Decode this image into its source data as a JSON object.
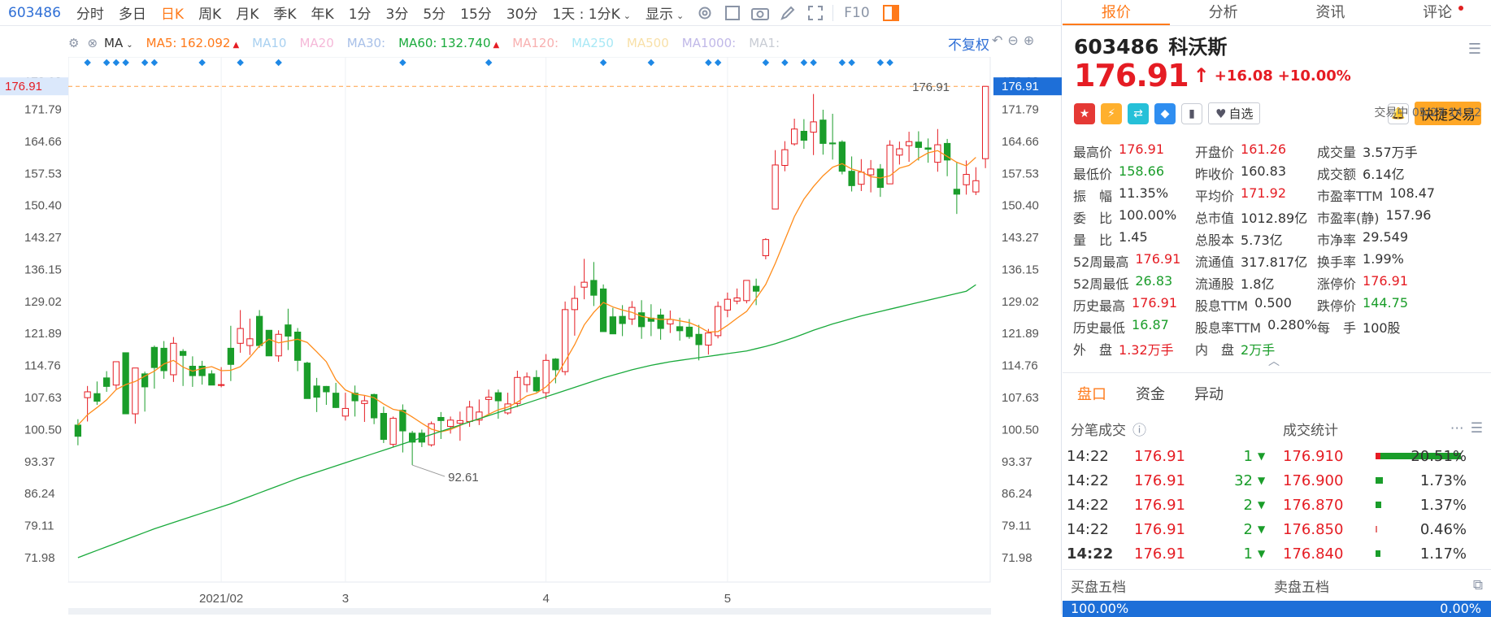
{
  "toolbar": {
    "symbol": "603486",
    "periods": [
      "分时",
      "多日",
      "日K",
      "周K",
      "月K",
      "季K",
      "年K",
      "1分",
      "3分",
      "5分",
      "15分",
      "30分"
    ],
    "active_period": "日K",
    "combo_label": "1天 : 1分K",
    "display_label": "显示",
    "f10_label": "F10"
  },
  "ma_bar": {
    "indicator": "MA",
    "items": [
      {
        "label": "MA5:",
        "value": "162.092",
        "color": "#ff7a1a",
        "arrow": "▲"
      },
      {
        "label": "MA10",
        "value": "",
        "color": "#a8d0f0",
        "arrow": ""
      },
      {
        "label": "MA20",
        "value": "",
        "color": "#f5b8d8",
        "arrow": ""
      },
      {
        "label": "MA30:",
        "value": "",
        "color": "#a8c0e8",
        "arrow": ""
      },
      {
        "label": "MA60:",
        "value": "132.740",
        "color": "#1aaa3c",
        "arrow": "▲"
      },
      {
        "label": "MA120:",
        "value": "",
        "color": "#f8b0b0",
        "arrow": ""
      },
      {
        "label": "MA250",
        "value": "",
        "color": "#a8e8f5",
        "arrow": ""
      },
      {
        "label": "MA500",
        "value": "",
        "color": "#f8e0a8",
        "arrow": ""
      },
      {
        "label": "MA1000:",
        "value": "",
        "color": "#c0b8e8",
        "arrow": ""
      },
      {
        "label": "MA1:",
        "value": "",
        "color": "#c8ccd4",
        "arrow": ""
      }
    ],
    "adjust_label": "不复权"
  },
  "chart_data": {
    "type": "candlestick",
    "y_ticks": [
      "178.03",
      "171.79",
      "164.66",
      "157.53",
      "150.40",
      "143.27",
      "136.15",
      "129.02",
      "121.89",
      "114.76",
      "107.63",
      "100.50",
      "93.37",
      "86.24",
      "79.11",
      "71.98"
    ],
    "ylim": [
      71.98,
      178.03
    ],
    "x_labels": [
      {
        "label": "2021/02",
        "index": 15
      },
      {
        "label": "3",
        "index": 28
      },
      {
        "label": "4",
        "index": 49
      },
      {
        "label": "5",
        "index": 68
      }
    ],
    "current_price_label": "176.91",
    "high_annotation": "176.91",
    "low_annotation": "92.61",
    "candles": [
      [
        101.5,
        102.8,
        99.0,
        97.0
      ],
      [
        107.6,
        110.2,
        108.9,
        102.3
      ],
      [
        108.5,
        111.2,
        106.8,
        106.0
      ],
      [
        112.0,
        113.5,
        110.1,
        108.9
      ],
      [
        110.4,
        113.0,
        115.6,
        109.5
      ],
      [
        117.6,
        117.6,
        104.0,
        104.0
      ],
      [
        104.0,
        113.4,
        114.2,
        101.8
      ],
      [
        112.9,
        113.4,
        110.0,
        104.5
      ],
      [
        118.8,
        119.2,
        114.3,
        109.6
      ],
      [
        118.6,
        120.2,
        113.6,
        111.8
      ],
      [
        112.7,
        121.1,
        119.7,
        111.1
      ],
      [
        117.9,
        118.4,
        117.0,
        110.2
      ],
      [
        114.6,
        116.8,
        112.5,
        110.0
      ],
      [
        114.6,
        115.8,
        112.5,
        110.5
      ],
      [
        112.9,
        113.7,
        110.4,
        110.4
      ],
      [
        110.4,
        114.4,
        110.5,
        109.9
      ],
      [
        118.6,
        123.6,
        115.0,
        111.3
      ],
      [
        119.7,
        127.1,
        123.0,
        117.6
      ],
      [
        119.2,
        125.2,
        120.7,
        117.1
      ],
      [
        125.7,
        127.1,
        119.2,
        118.7
      ],
      [
        122.6,
        122.6,
        116.9,
        116.9
      ],
      [
        116.9,
        122.6,
        121.7,
        115.6
      ],
      [
        123.8,
        127.4,
        121.3,
        118.2
      ],
      [
        122.2,
        123.1,
        115.9,
        113.5
      ],
      [
        115.3,
        115.6,
        107.4,
        107.4
      ],
      [
        110.2,
        112.0,
        107.7,
        104.4
      ],
      [
        110.1,
        110.2,
        108.9,
        106.0
      ],
      [
        108.6,
        110.9,
        105.4,
        105.3
      ],
      [
        103.5,
        108.7,
        105.2,
        102.5
      ],
      [
        108.6,
        110.3,
        106.9,
        103.4
      ],
      [
        106.3,
        108.1,
        106.9,
        102.2
      ],
      [
        108.3,
        108.5,
        103.1,
        101.7
      ],
      [
        104.1,
        105.6,
        98.3,
        97.5
      ],
      [
        97.2,
        103.4,
        103.0,
        96.6
      ],
      [
        104.8,
        106.1,
        100.2,
        95.4
      ],
      [
        99.7,
        100.2,
        97.7,
        92.6
      ],
      [
        99.7,
        100.5,
        97.7,
        96.6
      ],
      [
        97.1,
        102.3,
        101.8,
        96.7
      ],
      [
        103.2,
        104.4,
        102.5,
        98.4
      ],
      [
        101.2,
        103.4,
        102.6,
        99.6
      ],
      [
        101.9,
        104.5,
        102.5,
        98.0
      ],
      [
        102.3,
        106.9,
        105.5,
        101.1
      ],
      [
        102.6,
        107.2,
        104.4,
        101.5
      ],
      [
        107.2,
        109.4,
        107.7,
        104.0
      ],
      [
        108.7,
        109.4,
        106.9,
        102.9
      ],
      [
        104.2,
        108.7,
        106.2,
        103.8
      ],
      [
        106.3,
        113.6,
        112.1,
        105.5
      ],
      [
        110.5,
        113.2,
        112.2,
        108.8
      ],
      [
        112.1,
        113.7,
        109.1,
        108.8
      ],
      [
        108.7,
        117.3,
        115.9,
        107.3
      ],
      [
        116.2,
        116.4,
        113.8,
        110.8
      ],
      [
        113.4,
        129.0,
        127.2,
        112.6
      ],
      [
        127.2,
        132.5,
        129.7,
        121.4
      ],
      [
        132.2,
        138.5,
        133.3,
        129.5
      ],
      [
        133.7,
        137.8,
        130.4,
        128.0
      ],
      [
        131.8,
        132.8,
        122.3,
        122.3
      ],
      [
        125.6,
        127.6,
        121.8,
        121.8
      ],
      [
        125.7,
        128.2,
        124.1,
        121.3
      ],
      [
        125.1,
        129.1,
        127.7,
        123.8
      ],
      [
        126.5,
        129.3,
        123.4,
        120.7
      ],
      [
        125.3,
        128.4,
        124.6,
        121.3
      ],
      [
        126.0,
        127.4,
        123.0,
        120.5
      ],
      [
        124.0,
        127.0,
        125.0,
        122.0
      ],
      [
        123.4,
        125.4,
        122.5,
        120.3
      ],
      [
        123.3,
        125.1,
        121.2,
        120.7
      ],
      [
        121.7,
        123.8,
        119.4,
        115.9
      ],
      [
        119.3,
        122.9,
        122.0,
        117.2
      ],
      [
        121.4,
        129.0,
        127.9,
        120.8
      ],
      [
        127.1,
        131.0,
        129.5,
        125.5
      ],
      [
        129.1,
        131.9,
        129.8,
        128.4
      ],
      [
        129.2,
        132.2,
        133.7,
        128.6
      ],
      [
        132.4,
        134.1,
        131.3,
        128.2
      ],
      [
        139.2,
        143.1,
        142.8,
        138.4
      ],
      [
        149.6,
        162.7,
        159.4,
        149.6
      ],
      [
        159.3,
        164.7,
        162.8,
        158.0
      ],
      [
        164.1,
        169.7,
        167.4,
        163.7
      ],
      [
        166.9,
        169.6,
        164.9,
        163.0
      ],
      [
        166.7,
        175.2,
        169.0,
        161.6
      ],
      [
        169.4,
        171.7,
        164.2,
        161.7
      ],
      [
        164.3,
        170.8,
        164.1,
        160.6
      ],
      [
        164.5,
        164.9,
        158.0,
        157.3
      ],
      [
        158.0,
        161.3,
        154.8,
        153.5
      ],
      [
        155.1,
        160.7,
        157.8,
        153.6
      ],
      [
        157.2,
        160.5,
        158.5,
        153.3
      ],
      [
        158.5,
        159.6,
        154.4,
        152.3
      ],
      [
        155.2,
        164.9,
        163.8,
        155.2
      ],
      [
        161.6,
        164.6,
        163.0,
        159.5
      ],
      [
        163.7,
        166.8,
        164.6,
        160.1
      ],
      [
        164.5,
        166.9,
        163.3,
        160.4
      ],
      [
        163.2,
        165.3,
        162.9,
        159.9
      ],
      [
        160.0,
        167.4,
        163.9,
        157.9
      ],
      [
        164.2,
        165.2,
        160.5,
        156.9
      ],
      [
        154.0,
        159.9,
        152.9,
        148.5
      ],
      [
        155.0,
        160.4,
        157.3,
        152.8
      ],
      [
        153.4,
        158.9,
        155.9,
        152.7
      ],
      [
        160.8,
        176.9,
        176.9,
        158.7
      ]
    ],
    "ma5": [
      101.5,
      103.8,
      105.4,
      107.1,
      109.4,
      110.5,
      111.2,
      112.4,
      113.5,
      115.1,
      115.9,
      114.4,
      113.5,
      114.1,
      114.5,
      113.6,
      113.7,
      114.5,
      116.6,
      119.1,
      120.6,
      119.8,
      120.2,
      120.6,
      119.9,
      117.8,
      115.6,
      111.6,
      109.3,
      108.4,
      108.1,
      107.6,
      106.2,
      105.0,
      104.6,
      103.3,
      101.9,
      100.6,
      100.0,
      100.5,
      101.4,
      102.3,
      102.8,
      103.9,
      104.9,
      105.5,
      106.6,
      108.0,
      108.6,
      110.0,
      112.1,
      115.7,
      119.4,
      123.8,
      126.6,
      128.8,
      127.8,
      127.1,
      126.6,
      125.7,
      125.3,
      125.0,
      125.1,
      124.7,
      124.3,
      123.4,
      122.2,
      122.3,
      123.7,
      125.3,
      126.8,
      129.7,
      132.8,
      137.5,
      142.7,
      147.9,
      151.8,
      154.6,
      157.0,
      158.9,
      159.7,
      158.5,
      157.9,
      156.8,
      156.5,
      157.0,
      158.7,
      159.3,
      160.9,
      162.1,
      162.6,
      161.3,
      160.0,
      159.2,
      161.1
    ],
    "ma60": [
      71.98,
      72.8,
      73.6,
      74.4,
      75.2,
      76.0,
      76.8,
      77.6,
      78.4,
      79.1,
      79.8,
      80.5,
      81.2,
      81.9,
      82.6,
      83.3,
      84.0,
      84.8,
      85.6,
      86.4,
      87.2,
      88.0,
      88.8,
      89.6,
      90.3,
      91.0,
      91.7,
      92.4,
      93.1,
      93.8,
      94.5,
      95.2,
      95.9,
      96.6,
      97.3,
      98.0,
      98.7,
      99.4,
      100.1,
      100.8,
      101.5,
      102.2,
      102.9,
      103.6,
      104.3,
      105.0,
      105.7,
      106.4,
      107.1,
      107.8,
      108.5,
      109.2,
      109.9,
      110.6,
      111.3,
      112.0,
      112.6,
      113.2,
      113.8,
      114.3,
      114.8,
      115.2,
      115.6,
      115.9,
      116.2,
      116.5,
      116.8,
      117.1,
      117.4,
      117.7,
      118.0,
      118.5,
      119.0,
      119.6,
      120.3,
      121.0,
      121.8,
      122.6,
      123.3,
      124.0,
      124.6,
      125.2,
      125.8,
      126.3,
      126.8,
      127.3,
      127.8,
      128.3,
      128.8,
      129.3,
      129.8,
      130.3,
      130.8,
      131.3,
      132.74
    ]
  },
  "stock": {
    "code": "603486",
    "name": "科沃斯",
    "price": "176.91",
    "arrow": "↑",
    "change": "+16.08",
    "change_pct": "+10.00%",
    "status": "交易中 05/27 14:22",
    "watch_label": "自选",
    "trade_button": "快捷交易"
  },
  "panel_tabs": [
    "报价",
    "分析",
    "资讯",
    "评论"
  ],
  "quote_grid": [
    [
      {
        "l": "最高价",
        "v": "176.91",
        "c": "red"
      },
      {
        "l": "开盘价",
        "v": "161.26",
        "c": "red"
      },
      {
        "l": "成交量",
        "v": "3.57万手",
        "c": "dark"
      }
    ],
    [
      {
        "l": "最低价",
        "v": "158.66",
        "c": "green"
      },
      {
        "l": "昨收价",
        "v": "160.83",
        "c": "dark"
      },
      {
        "l": "成交额",
        "v": "6.14亿",
        "c": "dark"
      }
    ],
    [
      {
        "l": "振　幅",
        "v": "11.35%",
        "c": "dark"
      },
      {
        "l": "平均价",
        "v": "171.92",
        "c": "red"
      },
      {
        "l": "市盈率TTM",
        "v": "108.47",
        "c": "dark"
      }
    ],
    [
      {
        "l": "委　比",
        "v": "100.00%",
        "c": "dark"
      },
      {
        "l": "总市值",
        "v": "1012.89亿",
        "c": "dark"
      },
      {
        "l": "市盈率(静)",
        "v": "157.96",
        "c": "dark"
      }
    ],
    [
      {
        "l": "量　比",
        "v": "1.45",
        "c": "dark"
      },
      {
        "l": "总股本",
        "v": "5.73亿",
        "c": "dark"
      },
      {
        "l": "市净率",
        "v": "29.549",
        "c": "dark"
      }
    ],
    [
      {
        "l": "52周最高",
        "v": "176.91",
        "c": "red"
      },
      {
        "l": "流通值",
        "v": "317.817亿",
        "c": "dark"
      },
      {
        "l": "换手率",
        "v": "1.99%",
        "c": "dark"
      }
    ],
    [
      {
        "l": "52周最低",
        "v": "26.83",
        "c": "green"
      },
      {
        "l": "流通股",
        "v": "1.8亿",
        "c": "dark"
      },
      {
        "l": "涨停价",
        "v": "176.91",
        "c": "red"
      }
    ],
    [
      {
        "l": "历史最高",
        "v": "176.91",
        "c": "red"
      },
      {
        "l": "股息TTM",
        "v": "0.500",
        "c": "dark"
      },
      {
        "l": "跌停价",
        "v": "144.75",
        "c": "green"
      }
    ],
    [
      {
        "l": "历史最低",
        "v": "16.87",
        "c": "green"
      },
      {
        "l": "股息率TTM",
        "v": "0.280%",
        "c": "dark"
      },
      {
        "l": "每　手",
        "v": "100股",
        "c": "dark"
      }
    ],
    [
      {
        "l": "外　盘",
        "v": "1.32万手",
        "c": "red"
      },
      {
        "l": "内　盘",
        "v": "2万手",
        "c": "green"
      },
      {
        "l": "",
        "v": "",
        "c": "dark"
      }
    ]
  ],
  "section_tabs": [
    "盘口",
    "资金",
    "异动"
  ],
  "trades_title": "分笔成交",
  "trades": [
    {
      "time": "14:22",
      "price": "176.91",
      "vol": "1"
    },
    {
      "time": "14:22",
      "price": "176.91",
      "vol": "32"
    },
    {
      "time": "14:22",
      "price": "176.91",
      "vol": "2"
    },
    {
      "time": "14:22",
      "price": "176.91",
      "vol": "2"
    },
    {
      "time": "14:22",
      "price": "176.91",
      "vol": "1"
    }
  ],
  "stats_title": "成交统计",
  "stats": [
    {
      "price": "176.910",
      "pct": "20.51%",
      "fill": 0.2051
    },
    {
      "price": "176.900",
      "pct": "1.73%",
      "fill": 0.0173
    },
    {
      "price": "176.870",
      "pct": "1.37%",
      "fill": 0.0137
    },
    {
      "price": "176.850",
      "pct": "0.46%",
      "fill": 0.0046
    },
    {
      "price": "176.840",
      "pct": "1.17%",
      "fill": 0.0117
    }
  ],
  "book": {
    "buy_title": "买盘五档",
    "sell_title": "卖盘五档",
    "buy_pct": "100.00%",
    "sell_pct": "0.00%"
  }
}
